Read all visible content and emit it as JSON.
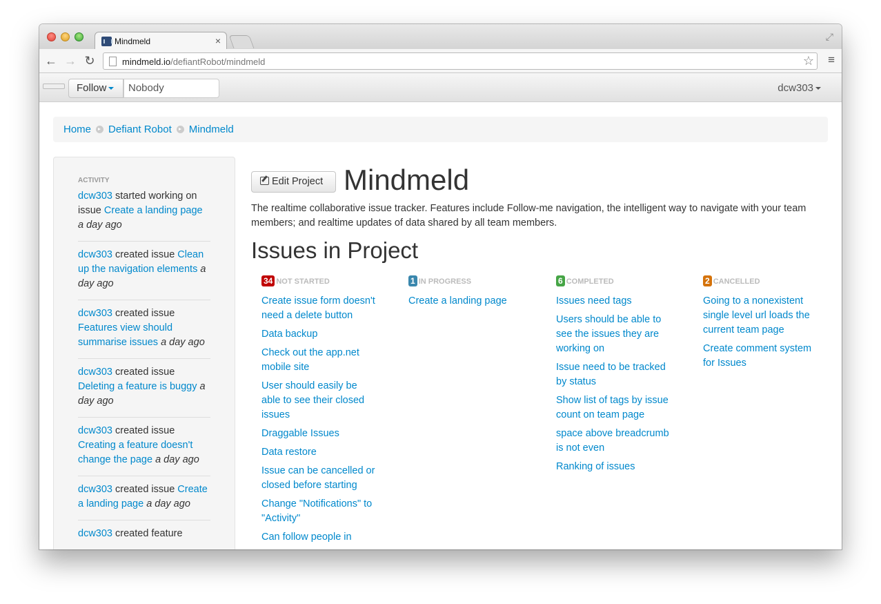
{
  "browser": {
    "tab_title": "Mindmeld",
    "tab_close": "×",
    "url_host": "mindmeld.io",
    "url_path": "/defiantRobot/mindmeld"
  },
  "navbar": {
    "follow_label": "Follow",
    "follow_value": "Nobody",
    "user": "dcw303"
  },
  "breadcrumb": [
    "Home",
    "Defiant Robot",
    "Mindmeld"
  ],
  "sidebar": {
    "header": "Activity",
    "items": [
      {
        "user": "dcw303",
        "action": " started working on issue ",
        "target": "Create a landing page",
        "time": "a day ago"
      },
      {
        "user": "dcw303",
        "action": " created issue ",
        "target": "Clean up the navigation elements",
        "time": "a day ago"
      },
      {
        "user": "dcw303",
        "action": " created issue ",
        "target": "Features view should summarise issues",
        "time": "a day ago"
      },
      {
        "user": "dcw303",
        "action": " created issue ",
        "target": "Deleting a feature is buggy",
        "time": "a day ago"
      },
      {
        "user": "dcw303",
        "action": " created issue ",
        "target": "Creating a feature doesn't change the page",
        "time": "a day ago"
      },
      {
        "user": "dcw303",
        "action": " created issue ",
        "target": "Create a landing page",
        "time": "a day ago"
      },
      {
        "user": "dcw303",
        "action": " created feature",
        "target": "",
        "time": ""
      }
    ]
  },
  "main": {
    "edit_label": "Edit Project",
    "title": "Mindmeld",
    "description": "The realtime collaborative issue tracker. Features include Follow-me navigation, the intelligent way to navigate with your team members; and realtime updates of data shared by all team members.",
    "issues_heading": "Issues in Project",
    "columns": [
      {
        "count": "34",
        "label": "Not Started",
        "color": "#c00000",
        "issues": [
          "Create issue form doesn't need a delete button",
          "Data backup",
          "Check out the app.net mobile site",
          "User should easily be able to see their closed issues",
          "Draggable Issues",
          "Data restore",
          "Issue can be cancelled or closed before starting",
          "Change \"Notifications\" to \"Activity\"",
          "Can follow people in"
        ]
      },
      {
        "count": "1",
        "label": "In Progress",
        "color": "#3a87ad",
        "issues": [
          "Create a landing page"
        ]
      },
      {
        "count": "6",
        "label": "Completed",
        "color": "#46a546",
        "issues": [
          "Issues need tags",
          "Users should be able to see the issues they are working on",
          "Issue need to be tracked by status",
          "Show list of tags by issue count on team page",
          "space above breadcrumb is not even",
          "Ranking of issues"
        ]
      },
      {
        "count": "2",
        "label": "Cancelled",
        "color": "#d5730b",
        "issues": [
          "Going to a nonexistent single level url loads the current team page",
          "Create comment system for Issues"
        ]
      }
    ]
  }
}
